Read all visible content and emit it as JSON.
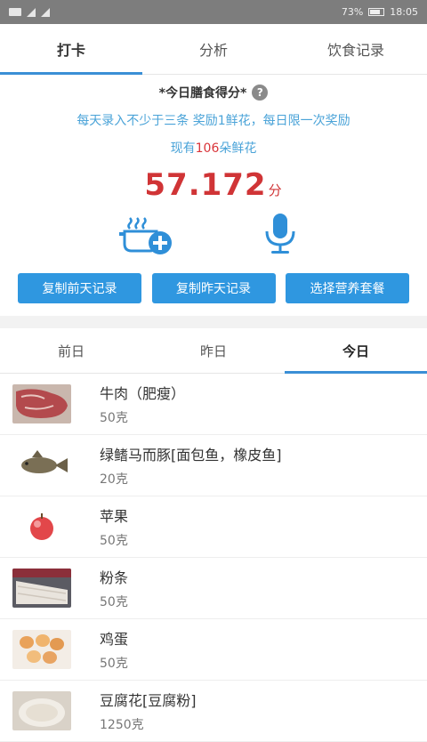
{
  "status_bar": {
    "battery_percent": "73%",
    "time": "18:05"
  },
  "top_tabs": [
    {
      "label": "打卡",
      "active": true
    },
    {
      "label": "分析",
      "active": false
    },
    {
      "label": "饮食记录",
      "active": false
    }
  ],
  "score_section": {
    "title": "*今日膳食得分*",
    "help_label": "?",
    "reward_text": "每天录入不少于三条 奖励1鲜花，每日限一次奖励",
    "flowers_prefix": "现有",
    "flowers_count": "106",
    "flowers_suffix": "朵鲜花",
    "score_value": "57.172",
    "score_unit": "分",
    "accent_color": "#d03436",
    "info_color": "#4aa3d8"
  },
  "icon_actions": {
    "add_meal_icon": "pot-add-icon",
    "voice_icon": "microphone-icon"
  },
  "action_buttons": [
    {
      "label": "复制前天记录"
    },
    {
      "label": "复制昨天记录"
    },
    {
      "label": "选择营养套餐"
    }
  ],
  "day_tabs": [
    {
      "label": "前日",
      "active": false
    },
    {
      "label": "昨日",
      "active": false
    },
    {
      "label": "今日",
      "active": true
    }
  ],
  "food_items": [
    {
      "name": "牛肉（肥瘦）",
      "quantity": "50克",
      "image": "beef"
    },
    {
      "name": "绿鳍马而豚[面包鱼，橡皮鱼]",
      "quantity": "20克",
      "image": "fish"
    },
    {
      "name": "苹果",
      "quantity": "50克",
      "image": "apple"
    },
    {
      "name": "粉条",
      "quantity": "50克",
      "image": "noodles"
    },
    {
      "name": "鸡蛋",
      "quantity": "50克",
      "image": "eggs"
    },
    {
      "name": "豆腐花[豆腐粉]",
      "quantity": "1250克",
      "image": "tofu"
    }
  ],
  "theme": {
    "primary_button": "#2f97e0",
    "tab_indicator": "#3a8fd6"
  }
}
